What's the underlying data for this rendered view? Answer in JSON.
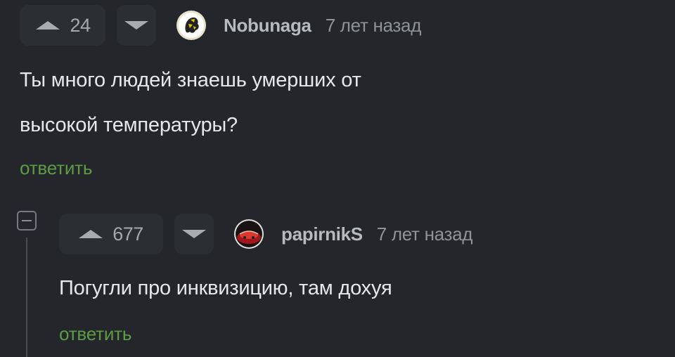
{
  "comments": [
    {
      "votes": "24",
      "author": "Nobunaga",
      "timestamp": "7 лет назад",
      "text_lines": [
        "Ты много людей знаешь умерших от",
        "высокой температуры?"
      ],
      "reply_label": "ответить"
    },
    {
      "votes": "677",
      "author": "papirnikS",
      "timestamp": "7 лет назад",
      "text_lines": [
        "Погугли про инквизицию, там дохуя"
      ],
      "reply_label": "ответить"
    }
  ],
  "colors": {
    "background": "#24262b",
    "reply_link": "#5b9c45",
    "vote_bg": "#2b2e33"
  },
  "icons": {
    "upvote": "upvote-icon",
    "downvote": "downvote-icon",
    "collapse": "collapse-icon"
  }
}
